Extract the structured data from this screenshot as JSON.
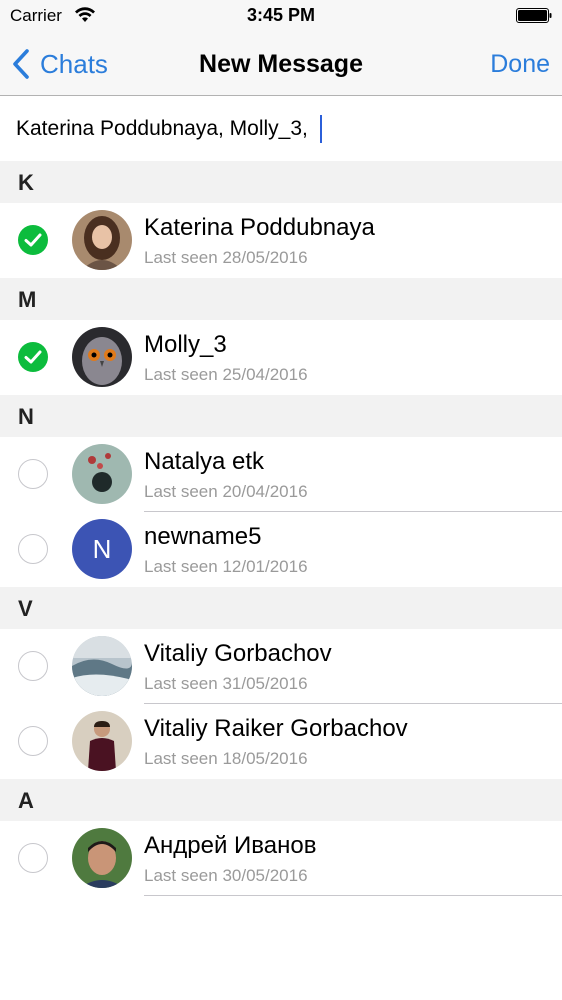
{
  "status_bar": {
    "carrier": "Carrier",
    "time": "3:45 PM"
  },
  "nav": {
    "back_label": "Chats",
    "title": "New Message",
    "done_label": "Done"
  },
  "recipients": {
    "text": "Katerina Poddubnaya,  Molly_3,"
  },
  "sections": [
    {
      "letter": "K",
      "contacts": [
        {
          "name": "Katerina Poddubnaya",
          "last_seen": "Last seen 28/05/2016",
          "checked": true
        }
      ]
    },
    {
      "letter": "M",
      "contacts": [
        {
          "name": "Molly_3",
          "last_seen": "Last seen 25/04/2016",
          "checked": true
        }
      ]
    },
    {
      "letter": "N",
      "contacts": [
        {
          "name": "Natalya etk",
          "last_seen": "Last seen 20/04/2016",
          "checked": false
        },
        {
          "name": "newname5",
          "last_seen": "Last seen 12/01/2016",
          "checked": false,
          "initial": "N"
        }
      ]
    },
    {
      "letter": "V",
      "contacts": [
        {
          "name": "Vitaliy Gorbachov",
          "last_seen": "Last seen 31/05/2016",
          "checked": false
        },
        {
          "name": "Vitaliy Raiker Gorbachov",
          "last_seen": "Last seen 18/05/2016",
          "checked": false
        }
      ]
    },
    {
      "letter": "A",
      "contacts": [
        {
          "name": "Андрей Иванов",
          "last_seen": "Last seen 30/05/2016",
          "checked": false
        }
      ]
    }
  ],
  "colors": {
    "accent": "#2b7ddb",
    "check_green": "#0cbc3d",
    "letter_avatar": "#3c54b4"
  }
}
